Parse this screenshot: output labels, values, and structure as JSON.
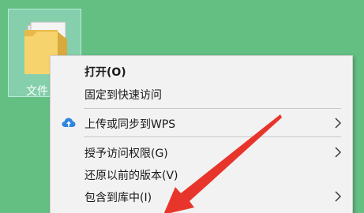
{
  "desktop": {
    "background_color": "#64bf83",
    "folder_icon": {
      "label": "文件",
      "icon_name": "folder-icon"
    }
  },
  "context_menu": {
    "items": [
      {
        "label": "打开(O)",
        "bold": true
      },
      {
        "label": "固定到快速访问"
      },
      {
        "label": "上传或同步到WPS",
        "icon": "cloud-upload-icon",
        "has_submenu": true
      },
      {
        "label": "授予访问权限(G)",
        "has_submenu": true
      },
      {
        "label": "还原以前的版本(V)"
      },
      {
        "label": "包含到库中(I)",
        "has_submenu": true
      }
    ]
  },
  "annotation": {
    "type": "arrow",
    "color": "#e8352b"
  }
}
